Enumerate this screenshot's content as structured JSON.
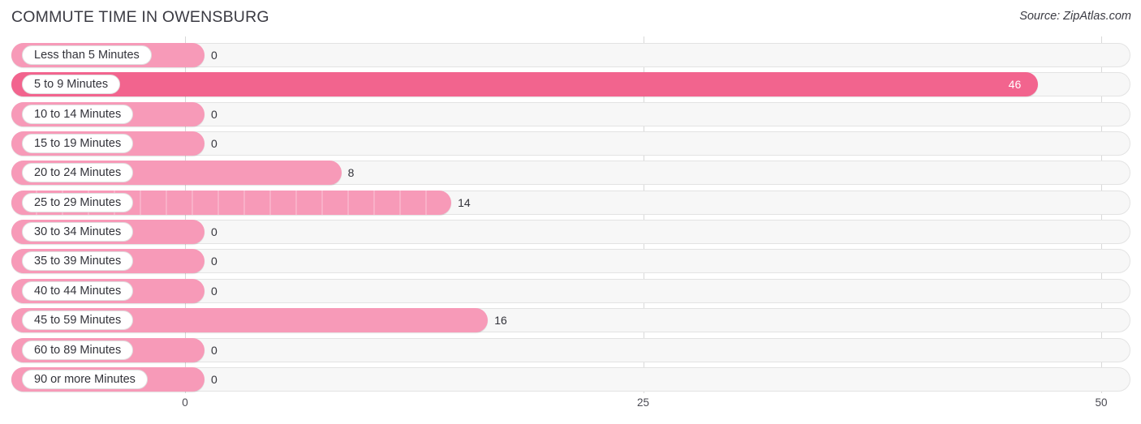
{
  "header": {
    "title": "COMMUTE TIME IN OWENSBURG",
    "source": "Source: ZipAtlas.com"
  },
  "colors": {
    "bar_light": "#f79ab8",
    "bar_dark": "#f2648e",
    "track": "#f7f7f7",
    "gridline": "#d8d8d8",
    "text": "#33333a"
  },
  "axis": {
    "ticks": [
      {
        "label": "0",
        "value": 0
      },
      {
        "label": "25",
        "value": 25
      },
      {
        "label": "50",
        "value": 50
      }
    ],
    "min": 0,
    "max": 50
  },
  "chart_data": {
    "type": "bar",
    "orientation": "horizontal",
    "title": "COMMUTE TIME IN OWENSBURG",
    "subtitle": "Source: ZipAtlas.com",
    "xlabel": "",
    "ylabel": "",
    "xlim": [
      0,
      50
    ],
    "grid": true,
    "legend": "none",
    "categories": [
      "Less than 5 Minutes",
      "5 to 9 Minutes",
      "10 to 14 Minutes",
      "15 to 19 Minutes",
      "20 to 24 Minutes",
      "25 to 29 Minutes",
      "30 to 34 Minutes",
      "35 to 39 Minutes",
      "40 to 44 Minutes",
      "45 to 59 Minutes",
      "60 to 89 Minutes",
      "90 or more Minutes"
    ],
    "values": [
      0,
      46,
      0,
      0,
      8,
      14,
      0,
      0,
      0,
      16,
      0,
      0
    ],
    "value_labels": [
      "0",
      "46",
      "0",
      "0",
      "8",
      "14",
      "0",
      "0",
      "0",
      "16",
      "0",
      "0"
    ]
  },
  "rows": [
    {
      "label": "Less than 5 Minutes",
      "value": 0,
      "value_label": "0",
      "shade": "light",
      "striped": false,
      "label_inside": false
    },
    {
      "label": "5 to 9 Minutes",
      "value": 46,
      "value_label": "46",
      "shade": "dark",
      "striped": false,
      "label_inside": true
    },
    {
      "label": "10 to 14 Minutes",
      "value": 0,
      "value_label": "0",
      "shade": "light",
      "striped": false,
      "label_inside": false
    },
    {
      "label": "15 to 19 Minutes",
      "value": 0,
      "value_label": "0",
      "shade": "light",
      "striped": false,
      "label_inside": false
    },
    {
      "label": "20 to 24 Minutes",
      "value": 8,
      "value_label": "8",
      "shade": "light",
      "striped": false,
      "label_inside": false
    },
    {
      "label": "25 to 29 Minutes",
      "value": 14,
      "value_label": "14",
      "shade": "light",
      "striped": true,
      "label_inside": false
    },
    {
      "label": "30 to 34 Minutes",
      "value": 0,
      "value_label": "0",
      "shade": "light",
      "striped": false,
      "label_inside": false
    },
    {
      "label": "35 to 39 Minutes",
      "value": 0,
      "value_label": "0",
      "shade": "light",
      "striped": false,
      "label_inside": false
    },
    {
      "label": "40 to 44 Minutes",
      "value": 0,
      "value_label": "0",
      "shade": "light",
      "striped": false,
      "label_inside": false
    },
    {
      "label": "45 to 59 Minutes",
      "value": 16,
      "value_label": "16",
      "shade": "light",
      "striped": false,
      "label_inside": false
    },
    {
      "label": "60 to 89 Minutes",
      "value": 0,
      "value_label": "0",
      "shade": "light",
      "striped": false,
      "label_inside": false
    },
    {
      "label": "90 or more Minutes",
      "value": 0,
      "value_label": "0",
      "shade": "light",
      "striped": false,
      "label_inside": false
    }
  ]
}
